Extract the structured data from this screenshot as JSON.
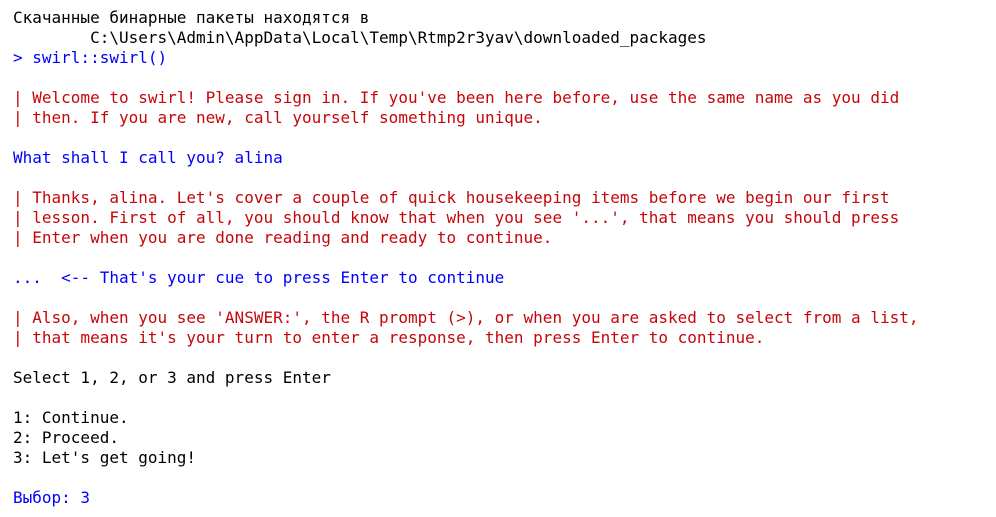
{
  "colors": {
    "output": "#000000",
    "message": "#c5060b",
    "input": "#0000ff"
  },
  "console": {
    "download_note": "Скачанные бинарные пакеты находятся в",
    "download_path": "        C:\\Users\\Admin\\AppData\\Local\\Temp\\Rtmp2r3yav\\downloaded_packages",
    "prompt_symbol": "> ",
    "command": "swirl::swirl()",
    "welcome_1": "| Welcome to swirl! Please sign in. If you've been here before, use the same name as you did",
    "welcome_2": "| then. If you are new, call yourself something unique.",
    "name_question": "What shall I call you? alina",
    "thanks_1": "| Thanks, alina. Let's cover a couple of quick housekeeping items before we begin our first",
    "thanks_2": "| lesson. First of all, you should know that when you see '...', that means you should press",
    "thanks_3": "| Enter when you are done reading and ready to continue.",
    "cue_line": "...  <-- That's your cue to press Enter to continue",
    "also_1": "| Also, when you see 'ANSWER:', the R prompt (>), or when you are asked to select from a list,",
    "also_2": "| that means it's your turn to enter a response, then press Enter to continue.",
    "select_prompt": "Select 1, 2, or 3 and press Enter",
    "options": [
      "1: Continue.",
      "2: Proceed.",
      "3: Let's get going!"
    ],
    "choice_line": "Выбор: 3"
  }
}
